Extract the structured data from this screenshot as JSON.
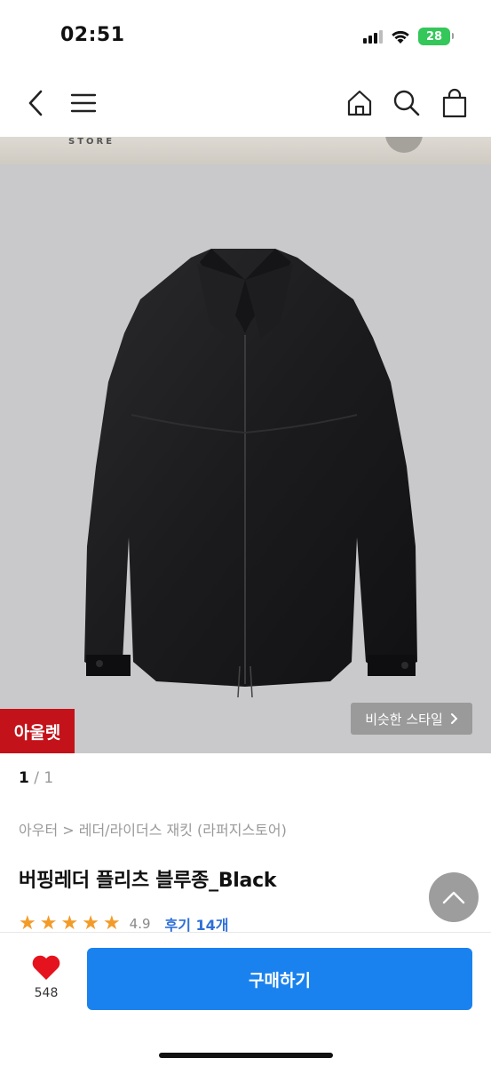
{
  "status": {
    "time": "02:51",
    "battery": "28"
  },
  "store": {
    "label": "STORE"
  },
  "gallery": {
    "current": "1",
    "separator": "/",
    "total": "1"
  },
  "badges": {
    "outlet": "아울렛",
    "similar_style": "비슷한 스타일"
  },
  "product": {
    "breadcrumb": "아우터 > 레더/라이더스 재킷 (라퍼지스토어)",
    "title": "버핑레더 플리츠 블루종_Black",
    "rating": "4.9",
    "stars": 5,
    "reviews": "후기 14개"
  },
  "actions": {
    "like_count": "548",
    "buy_label": "구매하기"
  },
  "colors": {
    "accent": "#1a82ee",
    "outlet_red": "#c4121a",
    "star": "#f39b29",
    "review_link": "#2e6fd8"
  },
  "icons": [
    "back-icon",
    "menu-icon",
    "home-icon",
    "search-icon",
    "bag-icon",
    "heart-icon",
    "chevron-right-icon",
    "chevron-up-icon"
  ]
}
